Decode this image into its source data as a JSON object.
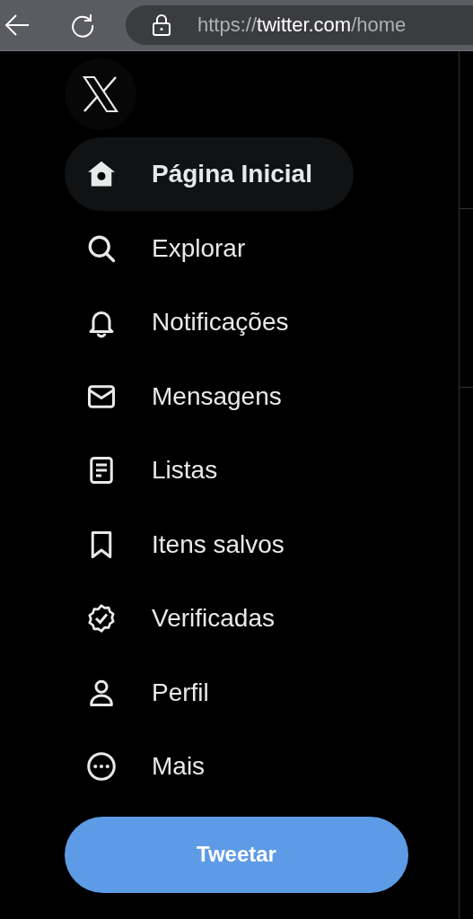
{
  "browser": {
    "url_scheme": "https://",
    "url_host": "twitter.com",
    "url_path": "/home"
  },
  "nav": {
    "items": [
      {
        "kind": "home",
        "label": "Página Inicial",
        "selected": true
      },
      {
        "kind": "explore",
        "label": "Explorar",
        "selected": false
      },
      {
        "kind": "bell",
        "label": "Notificações",
        "selected": false
      },
      {
        "kind": "mail",
        "label": "Mensagens",
        "selected": false
      },
      {
        "kind": "list",
        "label": "Listas",
        "selected": false
      },
      {
        "kind": "bookmark",
        "label": "Itens salvos",
        "selected": false
      },
      {
        "kind": "verified",
        "label": "Verificadas",
        "selected": false
      },
      {
        "kind": "person",
        "label": "Perfil",
        "selected": false
      },
      {
        "kind": "more",
        "label": "Mais",
        "selected": false
      }
    ],
    "post_button": "Tweetar"
  }
}
